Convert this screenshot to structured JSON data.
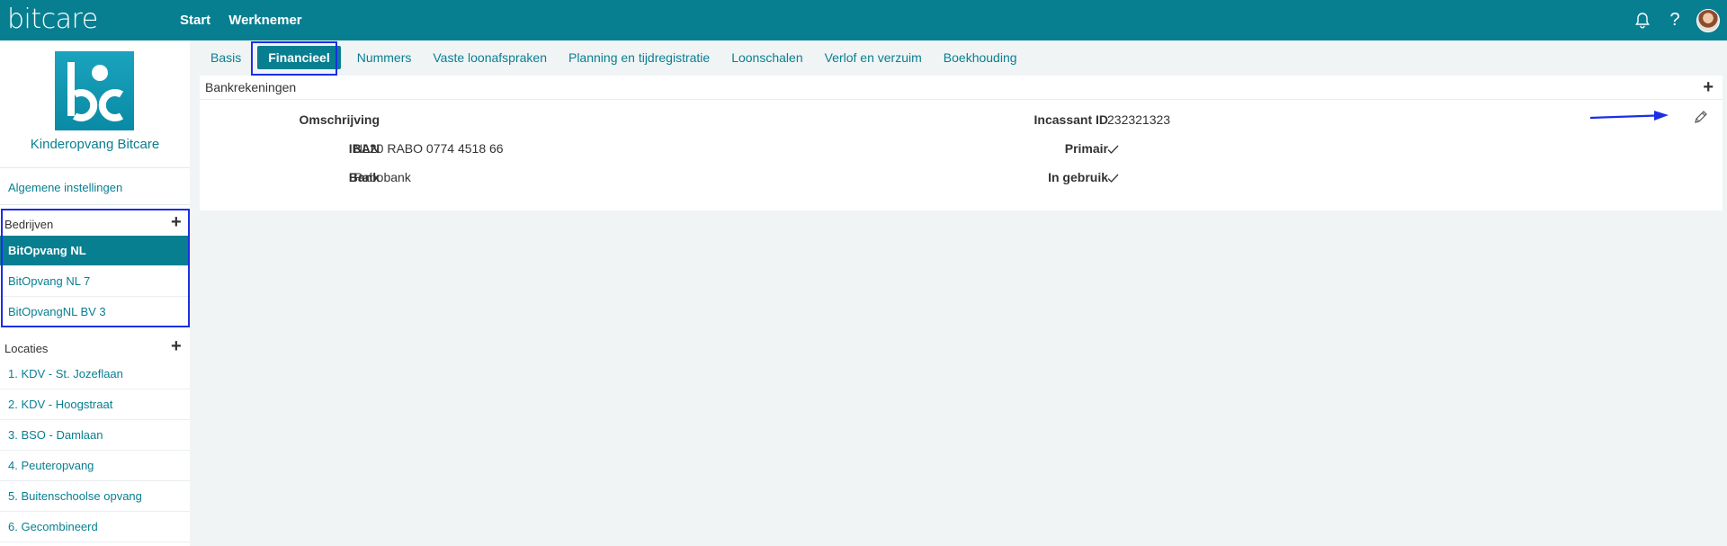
{
  "app": {
    "logo": "bitcare",
    "nav": [
      "Start",
      "Werknemer"
    ]
  },
  "topbar": {
    "icons": [
      "bell-icon",
      "question-icon",
      "avatar"
    ],
    "help_glyph": "?"
  },
  "sidebar": {
    "organization": "Kinderopvang Bitcare",
    "general_settings": "Algemene instellingen",
    "companies": {
      "title": "Bedrijven",
      "items": [
        "BitOpvang NL",
        "BitOpvang NL 7",
        "BitOpvangNL BV 3"
      ],
      "active_index": 0
    },
    "locations": {
      "title": "Locaties",
      "items": [
        "1. KDV - St. Jozeflaan",
        "2. KDV - Hoogstraat",
        "3. BSO - Damlaan",
        "4. Peuteropvang",
        "5. Buitenschoolse opvang",
        "6. Gecombineerd"
      ]
    }
  },
  "tabs": {
    "items": [
      "Basis",
      "Financieel",
      "Nummers",
      "Vaste loonafspraken",
      "Planning en tijdregistratie",
      "Loonschalen",
      "Verlof en verzuim",
      "Boekhouding"
    ],
    "active_index": 1
  },
  "bank_panel": {
    "title": "Bankrekeningen",
    "left_fields": [
      {
        "label": "Omschrijving",
        "value": ""
      },
      {
        "label": "IBAN",
        "value": "NL20 RABO 0774 4518 66"
      },
      {
        "label": "Bank",
        "value": "Rabobank"
      }
    ],
    "right_fields": [
      {
        "label": "Incassant ID",
        "value": "232321323"
      },
      {
        "label": "Primair",
        "check": true
      },
      {
        "label": "In gebruik",
        "check": true
      }
    ]
  },
  "colors": {
    "brand": "#087f91",
    "highlight": "#1c2ee6"
  }
}
